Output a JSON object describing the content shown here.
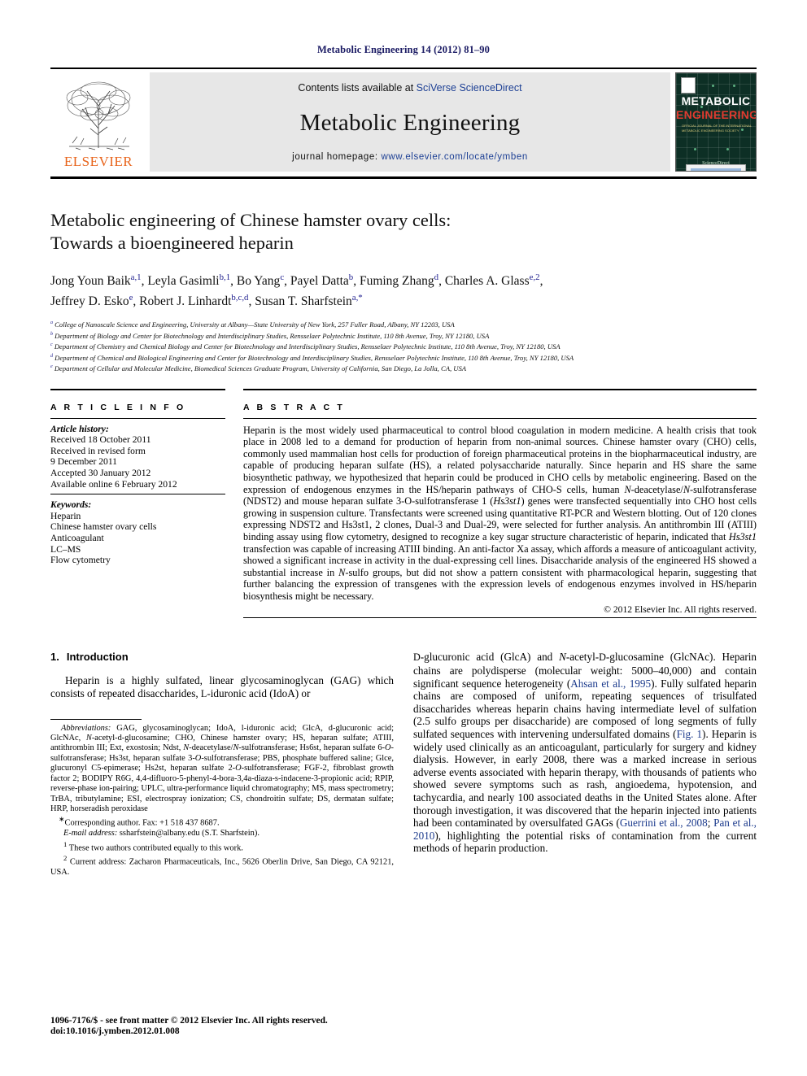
{
  "running_head": "Metabolic Engineering 14 (2012) 81–90",
  "banner": {
    "contents_prefix": "Contents lists available at ",
    "contents_link": "SciVerse ScienceDirect",
    "journal_title": "Metabolic Engineering",
    "homepage_prefix": "journal homepage: ",
    "homepage_link": "www.elsevier.com/locate/ymben",
    "publisher_logo_text": "ELSEVIER",
    "publisher_logo_name": "elsevier-tree-logo",
    "cover": {
      "line1": "METABOLIC",
      "line2": "ENGINEERING",
      "subtitle": "OFFICIAL JOURNAL OF\nTHE INTERNATIONAL METABOLIC ENGINEERING SOCIETY",
      "bottom": "ScienceDirect",
      "bg_color": "#0d2f25",
      "accent_color": "#e03a2f"
    }
  },
  "article": {
    "title_line1": "Metabolic engineering of Chinese hamster ovary cells:",
    "title_line2": "Towards a bioengineered heparin",
    "authors_line1": "Jong Youn Baik a,1, Leyla Gasimli b,1, Bo Yang c, Payel Datta b, Fuming Zhang d, Charles A. Glass e,2,",
    "authors_line2": "Jeffrey D. Esko e, Robert J. Linhardt b,c,d, Susan T. Sharfstein a,*",
    "affiliations": [
      {
        "marker": "a",
        "text": "College of Nanoscale Science and Engineering, University at Albany—State University of New York, 257 Fuller Road, Albany, NY 12203, USA"
      },
      {
        "marker": "b",
        "text": "Department of Biology and Center for Biotechnology and Interdisciplinary Studies, Rensselaer Polytechnic Institute, 110 8th Avenue, Troy, NY 12180, USA"
      },
      {
        "marker": "c",
        "text": "Department of Chemistry and Chemical Biology and Center for Biotechnology and Interdisciplinary Studies, Rensselaer Polytechnic Institute, 110 8th Avenue, Troy, NY 12180, USA"
      },
      {
        "marker": "d",
        "text": "Department of Chemical and Biological Engineering and Center for Biotechnology and Interdisciplinary Studies, Rensselaer Polytechnic Institute, 110 8th Avenue, Troy, NY 12180, USA"
      },
      {
        "marker": "e",
        "text": "Department of Cellular and Molecular Medicine, Biomedical Sciences Graduate Program, University of California, San Diego, La Jolla, CA, USA"
      }
    ]
  },
  "article_info": {
    "heading": "A R T I C L E   I N F O",
    "history_label": "Article history:",
    "history": [
      "Received 18 October 2011",
      "Received in revised form",
      "9 December 2011",
      "Accepted 30 January 2012",
      "Available online 6 February 2012"
    ],
    "keywords_label": "Keywords:",
    "keywords": [
      "Heparin",
      "Chinese hamster ovary cells",
      "Anticoagulant",
      "LC–MS",
      "Flow cytometry"
    ]
  },
  "abstract": {
    "heading": "A B S T R A C T",
    "text": "Heparin is the most widely used pharmaceutical to control blood coagulation in modern medicine. A health crisis that took place in 2008 led to a demand for production of heparin from non-animal sources. Chinese hamster ovary (CHO) cells, commonly used mammalian host cells for production of foreign pharmaceutical proteins in the biopharmaceutical industry, are capable of producing heparan sulfate (HS), a related polysaccharide naturally. Since heparin and HS share the same biosynthetic pathway, we hypothesized that heparin could be produced in CHO cells by metabolic engineering. Based on the expression of endogenous enzymes in the HS/heparin pathways of CHO-S cells, human N-deacetylase/N-sulfotransferase (NDST2) and mouse heparan sulfate 3-O-sulfotransferase 1 (Hs3st1) genes were transfected sequentially into CHO host cells growing in suspension culture. Transfectants were screened using quantitative RT-PCR and Western blotting. Out of 120 clones expressing NDST2 and Hs3st1, 2 clones, Dual-3 and Dual-29, were selected for further analysis. An antithrombin III (ATIII) binding assay using flow cytometry, designed to recognize a key sugar structure characteristic of heparin, indicated that Hs3st1 transfection was capable of increasing ATIII binding. An anti-factor Xa assay, which affords a measure of anticoagulant activity, showed a significant increase in activity in the dual-expressing cell lines. Disaccharide analysis of the engineered HS showed a substantial increase in N-sulfo groups, but did not show a pattern consistent with pharmacological heparin, suggesting that further balancing the expression of transgenes with the expression levels of endogenous enzymes involved in HS/heparin biosynthesis might be necessary.",
    "copyright": "© 2012 Elsevier Inc. All rights reserved."
  },
  "section": {
    "number": "1.",
    "title": "Introduction"
  },
  "body": {
    "left_para": "Heparin is a highly sulfated, linear glycosaminoglycan (GAG) which consists of repeated disaccharides, L-iduronic acid (IdoA) or",
    "right_para_1": "D-glucuronic acid (GlcA) and N-acetyl-D-glucosamine (GlcNAc). Heparin chains are polydisperse (molecular weight: 5000–40,000) and contain significant sequence heterogeneity (Ahsan et al., 1995). Fully sulfated heparin chains are composed of uniform, repeating sequences of trisulfated disaccharides whereas heparin chains having intermediate level of sulfation (2.5 sulfo groups per disaccharide) are composed of long segments of fully sulfated sequences with intervening undersulfated domains (Fig. 1). Heparin is widely used clinically as an anticoagulant, particularly for surgery and kidney dialysis. However, in early 2008, there was a marked increase in serious adverse events associated with heparin therapy, with thousands of patients who showed severe symptoms such as rash, angioedema, hypotension, and tachycardia, and nearly 100 associated deaths in the United States alone. After thorough investigation, it was discovered that the heparin injected into patients had been contaminated by oversulfated GAGs (Guerrini et al., 2008; Pan et al., 2010), highlighting the potential risks of contamination from the current methods of heparin production.",
    "citations": [
      "Ahsan et al., 1995",
      "Fig. 1",
      "Guerrini et al., 2008",
      "Pan et al., 2010"
    ]
  },
  "footnotes": {
    "abbreviations_label": "Abbreviations:",
    "abbreviations_text": "GAG, glycosaminoglycan; IdoA, l-iduronic acid; GlcA, d-glucuronic acid; GlcNAc, N-acetyl-d-glucosamine; CHO, Chinese hamster ovary; HS, heparan sulfate; ATIII, antithrombin III; Ext, exostosin; Ndst, N-deacetylase/N-sulfotransferase; Hs6st, heparan sulfate 6-O-sulfotransferase; Hs3st, heparan sulfate 3-O-sulfotransferase; PBS, phosphate buffered saline; Glce, glucuronyl C5-epimerase; Hs2st, heparan sulfate 2-O-sulfotransferase; FGF-2, fibroblast growth factor 2; BODIPY R6G, 4,4-difluoro-5-phenyl-4-bora-3,4a-diaza-s-indacene-3-propionic acid; RPIP, reverse-phase ion-pairing; UPLC, ultra-performance liquid chromatography; MS, mass spectrometry; TrBA, tributylamine; ESI, electrospray ionization; CS, chondroitin sulfate; DS, dermatan sulfate; HRP, horseradish peroxidase",
    "corresponding": "Corresponding author. Fax: +1 518 437 8687.",
    "email_label": "E-mail address:",
    "email_text": "ssharfstein@albany.edu (S.T. Sharfstein).",
    "note1_marker": "1",
    "note1": "These two authors contributed equally to this work.",
    "note2_marker": "2",
    "note2": "Current address: Zacharon Pharmaceuticals, Inc., 5626 Oberlin Drive, San Diego, CA 92121, USA."
  },
  "imprint": {
    "line1": "1096-7176/$ - see front matter © 2012 Elsevier Inc. All rights reserved.",
    "line2": "doi:10.1016/j.ymben.2012.01.008"
  }
}
